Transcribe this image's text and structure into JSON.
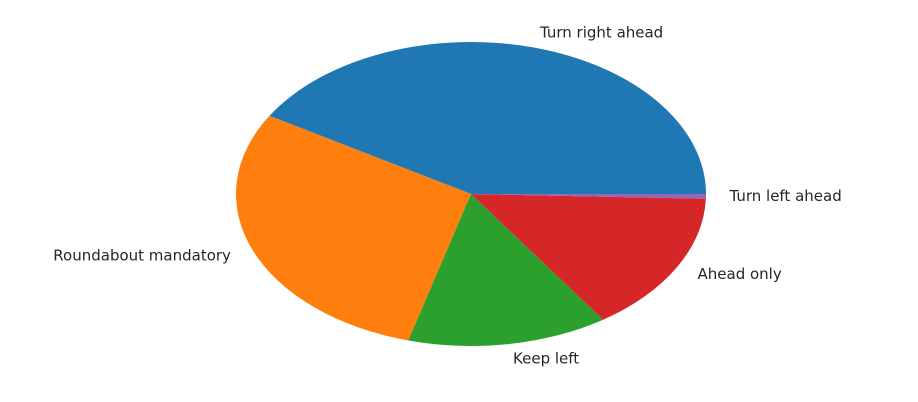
{
  "chart_data": {
    "type": "pie",
    "title": "",
    "start_angle_deg": 0,
    "direction": "counterclockwise",
    "slices": [
      {
        "label": "Turn right ahead",
        "value": 41.4,
        "color": "#1f77b4"
      },
      {
        "label": "Roundabout mandatory",
        "value": 29.3,
        "color": "#ff7f0e"
      },
      {
        "label": "Keep left",
        "value": 13.8,
        "color": "#2ca02c"
      },
      {
        "label": "Ahead only",
        "value": 15.0,
        "color": "#d62728"
      },
      {
        "label": "Turn left ahead",
        "value": 0.5,
        "color": "#9467bd"
      }
    ],
    "legend": "none"
  }
}
